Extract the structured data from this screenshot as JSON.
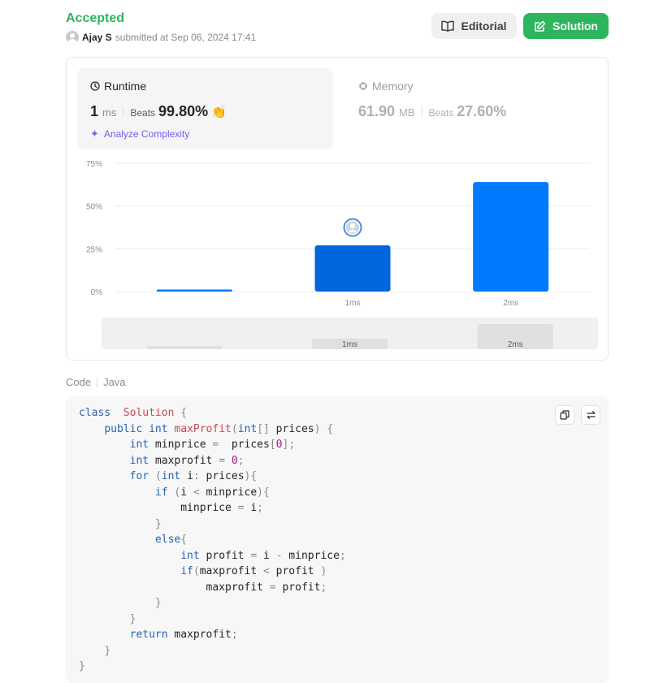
{
  "submission": {
    "status": "Accepted",
    "user": "Ajay S",
    "submitted_text": "submitted at Sep 06, 2024 17:41"
  },
  "buttons": {
    "editorial": "Editorial",
    "solution": "Solution"
  },
  "runtime": {
    "label": "Runtime",
    "value": "1",
    "unit": "ms",
    "beats_label": "Beats",
    "beats_value": "99.80%",
    "analyze": "Analyze Complexity"
  },
  "memory": {
    "label": "Memory",
    "value": "61.90",
    "unit": "MB",
    "beats_label": "Beats",
    "beats_value": "27.60%"
  },
  "chart_data": {
    "type": "bar",
    "categories": [
      "",
      "1ms",
      "2ms"
    ],
    "values": [
      1.2,
      27,
      64
    ],
    "ylim": [
      0,
      75
    ],
    "y_ticks": [
      "0%",
      "25%",
      "50%",
      "75%"
    ],
    "grid": true,
    "highlighted_category": "1ms",
    "colors": {
      "bar": "#007aff",
      "highlight": "#0066dd",
      "grid": "#ececec",
      "tick": "#8c8c8c",
      "navigator_bg": "#f0f0f0",
      "navigator_bar": "#e0e0e0"
    }
  },
  "code": {
    "label": "Code",
    "language": "Java",
    "lines": [
      [
        [
          "kw",
          "class"
        ],
        [
          "",
          "  "
        ],
        [
          "fn",
          "Solution"
        ],
        [
          "pn",
          " {"
        ]
      ],
      [
        [
          "",
          "    "
        ],
        [
          "kw",
          "public"
        ],
        [
          "",
          " "
        ],
        [
          "kw",
          "int"
        ],
        [
          "",
          " "
        ],
        [
          "fn",
          "maxProfit"
        ],
        [
          "pn",
          "("
        ],
        [
          "kw",
          "int"
        ],
        [
          "pn",
          "[]"
        ],
        [
          "",
          " prices"
        ],
        [
          "pn",
          ")"
        ],
        [
          "pn",
          " {"
        ]
      ],
      [
        [
          "",
          "        "
        ],
        [
          "kw",
          "int"
        ],
        [
          "",
          " minprice "
        ],
        [
          "pn",
          "="
        ],
        [
          "",
          "  prices"
        ],
        [
          "pn",
          "["
        ],
        [
          "num",
          "0"
        ],
        [
          "pn",
          "];"
        ]
      ],
      [
        [
          "",
          "        "
        ],
        [
          "kw",
          "int"
        ],
        [
          "",
          " maxprofit "
        ],
        [
          "pn",
          "="
        ],
        [
          "",
          " "
        ],
        [
          "num",
          "0"
        ],
        [
          "pn",
          ";"
        ]
      ],
      [
        [
          "",
          "        "
        ],
        [
          "kw",
          "for"
        ],
        [
          "",
          " "
        ],
        [
          "pn",
          "("
        ],
        [
          "kw",
          "int"
        ],
        [
          "",
          " i"
        ],
        [
          "pn",
          ":"
        ],
        [
          "",
          " prices"
        ],
        [
          "pn",
          "){"
        ]
      ],
      [
        [
          "",
          "            "
        ],
        [
          "kw",
          "if"
        ],
        [
          "",
          " "
        ],
        [
          "pn",
          "("
        ],
        [
          "",
          "i "
        ],
        [
          "pn",
          "<"
        ],
        [
          "",
          " minprice"
        ],
        [
          "pn",
          "){"
        ]
      ],
      [
        [
          "",
          "                minprice "
        ],
        [
          "pn",
          "="
        ],
        [
          "",
          " i"
        ],
        [
          "pn",
          ";"
        ]
      ],
      [
        [
          "",
          "            "
        ],
        [
          "pn",
          "}"
        ]
      ],
      [
        [
          "",
          "            "
        ],
        [
          "kw",
          "else"
        ],
        [
          "pn",
          "{"
        ]
      ],
      [
        [
          "",
          "                "
        ],
        [
          "kw",
          "int"
        ],
        [
          "",
          " profit "
        ],
        [
          "pn",
          "="
        ],
        [
          "",
          " i "
        ],
        [
          "pn",
          "-"
        ],
        [
          "",
          " minprice"
        ],
        [
          "pn",
          ";"
        ]
      ],
      [
        [
          "",
          "                "
        ],
        [
          "kw",
          "if"
        ],
        [
          "pn",
          "("
        ],
        [
          "",
          "maxprofit "
        ],
        [
          "pn",
          "<"
        ],
        [
          "",
          " profit "
        ],
        [
          "pn",
          ")"
        ]
      ],
      [
        [
          "",
          "                    maxprofit "
        ],
        [
          "pn",
          "="
        ],
        [
          "",
          " profit"
        ],
        [
          "pn",
          ";"
        ]
      ],
      [
        [
          "",
          "            "
        ],
        [
          "pn",
          "}"
        ]
      ],
      [
        [
          "",
          "        "
        ],
        [
          "pn",
          "}"
        ]
      ],
      [
        [
          "",
          "        "
        ],
        [
          "kw",
          "return"
        ],
        [
          "",
          " maxprofit"
        ],
        [
          "pn",
          ";"
        ]
      ],
      [
        [
          "",
          "    "
        ],
        [
          "pn",
          "}"
        ]
      ],
      [
        [
          "pn",
          "}"
        ]
      ]
    ]
  }
}
